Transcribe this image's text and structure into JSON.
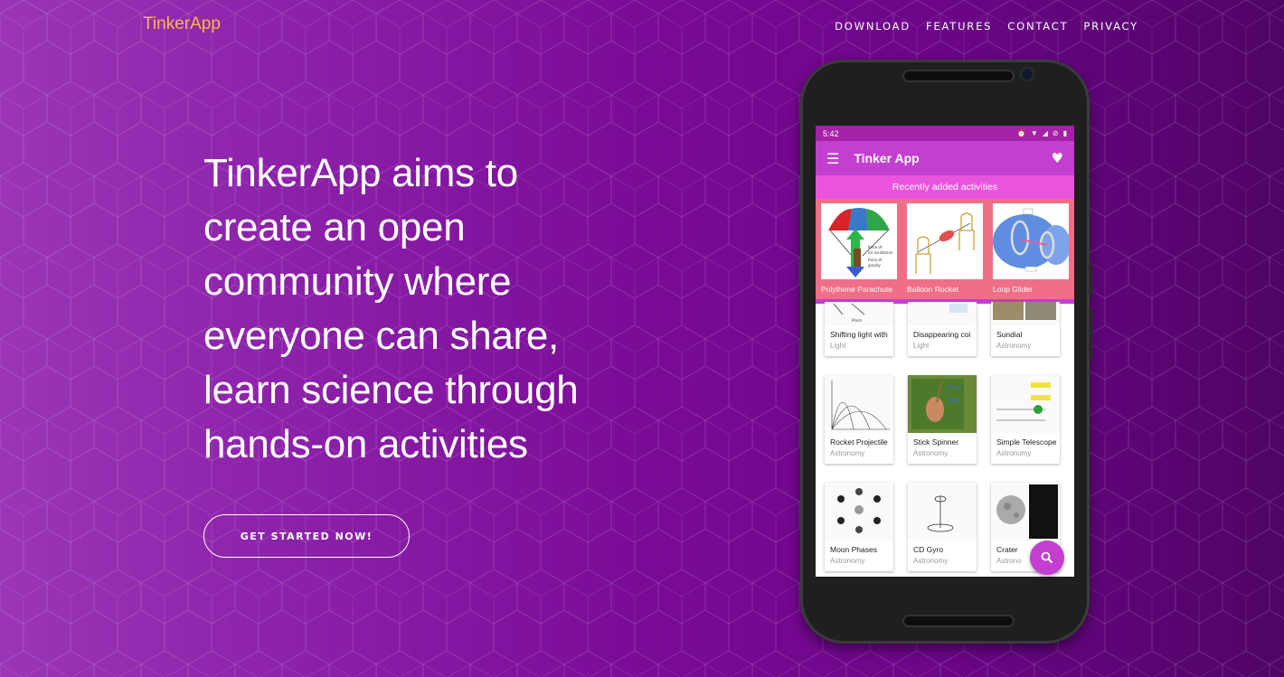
{
  "nav": {
    "brand": "TinkerApp",
    "links": [
      "DOWNLOAD",
      "FEATURES",
      "CONTACT",
      "PRIVACY"
    ]
  },
  "hero": {
    "headline_lines": [
      "TinkerApp aims to",
      "create an open",
      "community where",
      "everyone can share,",
      "learn science through",
      "hands-on activities"
    ],
    "cta_label": "GET STARTED NOW!"
  },
  "phone": {
    "status": {
      "time": "5:42",
      "icons": [
        "alarm-icon",
        "wifi-icon",
        "signal-icon",
        "no-sim-icon",
        "battery-icon"
      ]
    },
    "appbar": {
      "title": "Tinker App",
      "menu_icon": "menu-icon",
      "action_icon": "heart-icon"
    },
    "recent": {
      "header": "Recently added activities",
      "items": [
        {
          "label": "Polythene Parachute"
        },
        {
          "label": "Balloon Rocket"
        },
        {
          "label": "Loop Glider"
        }
      ]
    },
    "activities": [
      {
        "title": "Shifting light with",
        "category": "Light"
      },
      {
        "title": "Disappearing coi",
        "category": "Light"
      },
      {
        "title": "Sundial",
        "category": "Astronomy"
      },
      {
        "title": "Rocket Projectile",
        "category": "Astronomy"
      },
      {
        "title": "Stick Spinner",
        "category": "Astronomy"
      },
      {
        "title": "Simple Telescope",
        "category": "Astronomy"
      },
      {
        "title": "Moon Phases",
        "category": "Astronomy"
      },
      {
        "title": "CD Gyro",
        "category": "Astronomy"
      },
      {
        "title": "Crater",
        "category": "Astrono"
      }
    ],
    "fab_icon": "search-icon"
  },
  "colors": {
    "brand": "#fdb846",
    "app_primary": "#c33fcf",
    "status_bar": "#a522a8",
    "recent_header": "#ea54dd",
    "recent_strip": "#f06f86"
  }
}
